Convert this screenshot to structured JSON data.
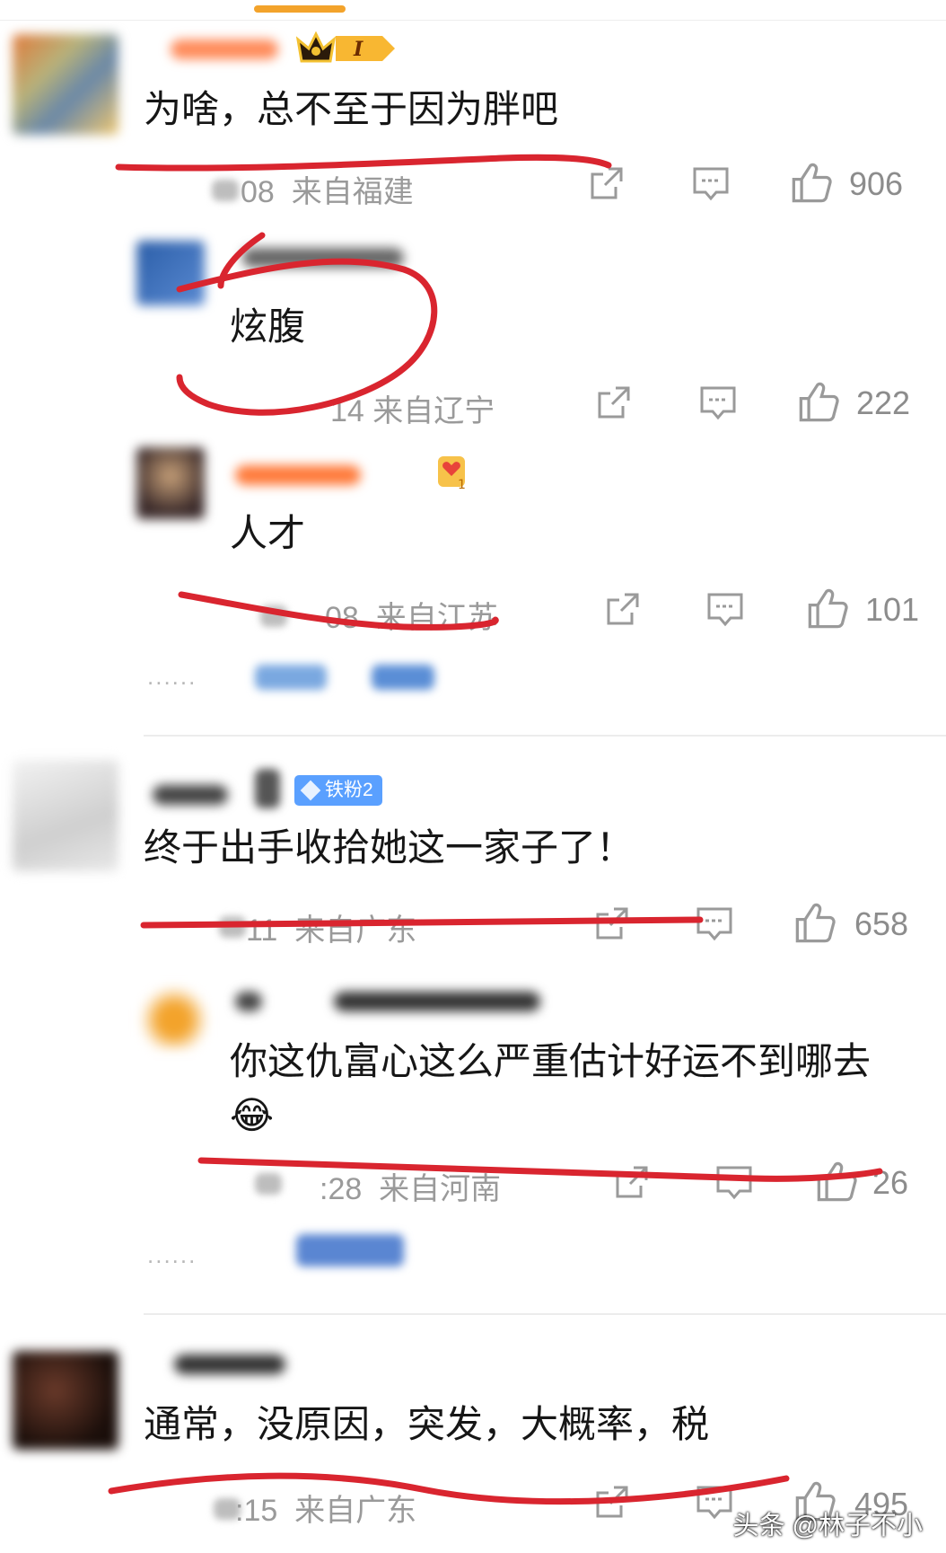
{
  "comments": [
    {
      "text": "为啥，总不至于因为胖吧",
      "time": "08",
      "location": "来自福建",
      "likes": "906",
      "replies": [
        {
          "text": "炫腹",
          "time": "14",
          "location": "来自辽宁",
          "likes": "222"
        },
        {
          "text": "人才",
          "time": "08",
          "location": "来自江苏",
          "likes": "101"
        }
      ],
      "more_dots": "......"
    },
    {
      "text": "终于出手收拾她这一家子了！",
      "badge": "铁粉2",
      "time": "11",
      "location": "来自广东",
      "likes": "658",
      "replies": [
        {
          "text": "你这仇富心这么严重估计好运不到哪去😂",
          "time": ":28",
          "location": "来自河南",
          "likes": "26"
        }
      ],
      "more_dots": "......"
    },
    {
      "text": "通常，没原因，突发，大概率，税",
      "time": ":15",
      "location": "来自广东",
      "likes": "495"
    }
  ],
  "watermark": "头条 @林子不小",
  "icons": [
    "share-icon",
    "comment-icon",
    "like-icon"
  ],
  "colors": {
    "annotation": "#d9252f",
    "accent": "#f3a32b",
    "fan_badge": "#5aa0ff"
  }
}
